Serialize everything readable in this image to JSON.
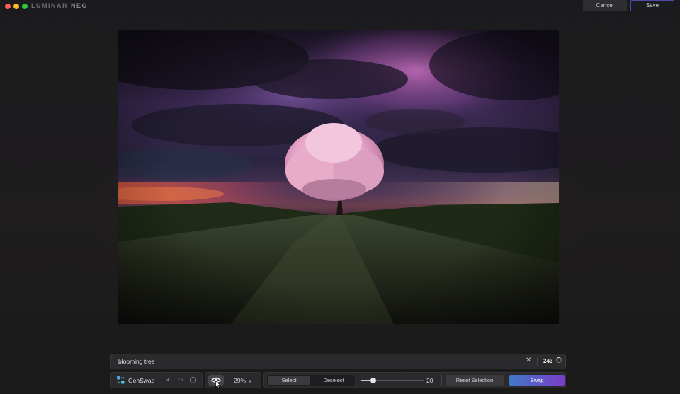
{
  "app": {
    "brand_main": "LUMINAR",
    "brand_sub": "NEO"
  },
  "header": {
    "cancel_label": "Cancel",
    "save_label": "Save"
  },
  "prompt": {
    "value": "blooming tree",
    "count": "243"
  },
  "toolbar": {
    "tool_label": "GenSwap",
    "zoom_value": "29%",
    "select_label": "Select",
    "deselect_label": "Deselect",
    "brush_size": "20",
    "brush_size_fraction": 0.2,
    "reset_label": "Reset Selection",
    "swap_label": "Swap"
  },
  "icons": {
    "tool": "genswap-icon",
    "undo": "undo-icon",
    "redo": "redo-icon",
    "info": "info-icon",
    "preview": "eye-icon",
    "zoom": "chevron-down-icon",
    "clear": "close-icon"
  },
  "colors": {
    "accent_start": "#3f79c8",
    "accent_end": "#7a3dc8",
    "save_border": "#4f4aa8"
  }
}
